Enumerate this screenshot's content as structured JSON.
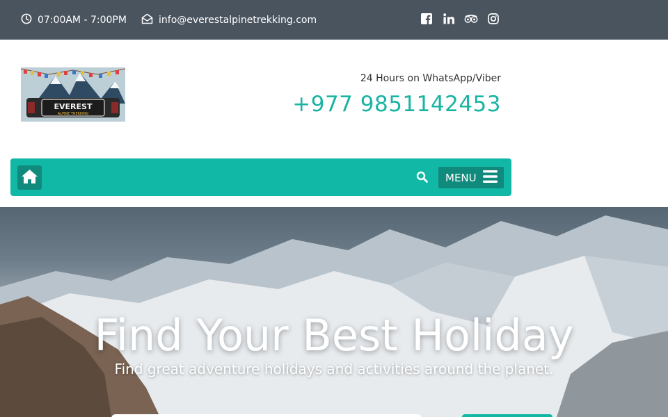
{
  "topbar": {
    "hours": "07:00AM - 7:00PM",
    "email": "info@everestalpinetrekking.com",
    "social": [
      "facebook-icon",
      "linkedin-icon",
      "tripadvisor-icon",
      "instagram-icon"
    ]
  },
  "header": {
    "logo_text_main": "EVEREST",
    "logo_text_sub": "ALPINE TREKKING",
    "contact_label": "24 Hours on WhatsApp/Viber",
    "phone": "+977 9851142453"
  },
  "nav": {
    "menu_label": "MENU"
  },
  "hero": {
    "title": "Find Your Best Holiday",
    "subtitle": "Find great adventure holidays and activities around the planet."
  },
  "colors": {
    "topbar_bg": "#4a545f",
    "accent": "#12b8a6",
    "accent_dark": "#0f8a7c",
    "phone_text": "#1ab4a3"
  }
}
